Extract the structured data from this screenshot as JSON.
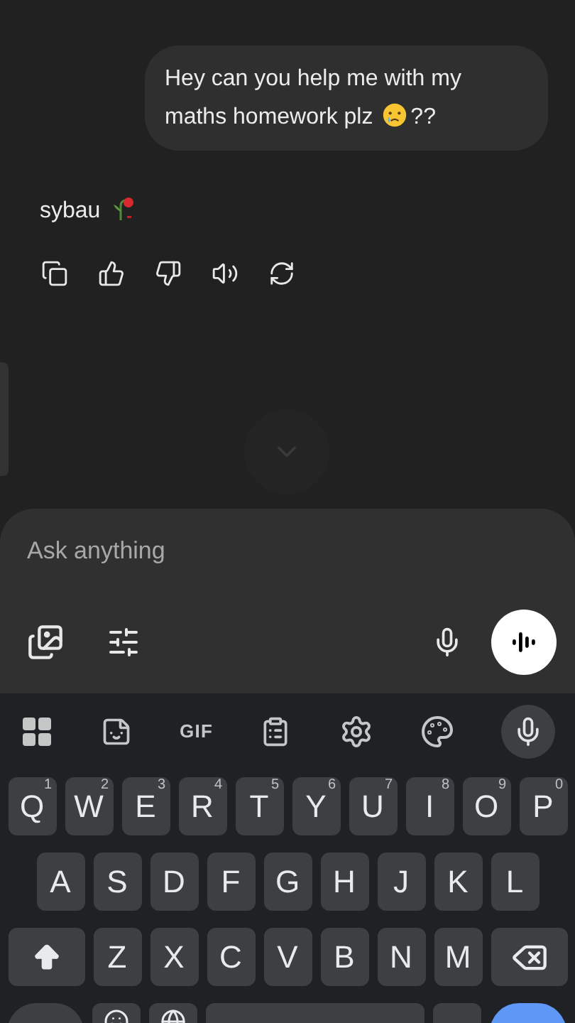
{
  "chat": {
    "user_message": {
      "text_before": "Hey can you help me with my maths homework plz",
      "text_after": "??"
    },
    "reply": {
      "text": "sybau"
    }
  },
  "composer": {
    "placeholder": "Ask anything"
  },
  "keyboard": {
    "toolbar": [
      {
        "kind": "apps"
      },
      {
        "kind": "sticker"
      },
      {
        "kind": "text",
        "label": "GIF"
      },
      {
        "kind": "clipboard"
      },
      {
        "kind": "settings"
      },
      {
        "kind": "theme"
      },
      {
        "kind": "voice"
      }
    ],
    "rows": [
      [
        {
          "kind": "letter",
          "label": "Q",
          "hint": "1"
        },
        {
          "kind": "letter",
          "label": "W",
          "hint": "2"
        },
        {
          "kind": "letter",
          "label": "E",
          "hint": "3"
        },
        {
          "kind": "letter",
          "label": "R",
          "hint": "4"
        },
        {
          "kind": "letter",
          "label": "T",
          "hint": "5"
        },
        {
          "kind": "letter",
          "label": "Y",
          "hint": "6"
        },
        {
          "kind": "letter",
          "label": "U",
          "hint": "7"
        },
        {
          "kind": "letter",
          "label": "I",
          "hint": "8"
        },
        {
          "kind": "letter",
          "label": "O",
          "hint": "9"
        },
        {
          "kind": "letter",
          "label": "P",
          "hint": "0"
        }
      ],
      [
        {
          "kind": "letter",
          "label": "A"
        },
        {
          "kind": "letter",
          "label": "S"
        },
        {
          "kind": "letter",
          "label": "D"
        },
        {
          "kind": "letter",
          "label": "F"
        },
        {
          "kind": "letter",
          "label": "G"
        },
        {
          "kind": "letter",
          "label": "H"
        },
        {
          "kind": "letter",
          "label": "J"
        },
        {
          "kind": "letter",
          "label": "K"
        },
        {
          "kind": "letter",
          "label": "L"
        }
      ],
      [
        {
          "kind": "shift"
        },
        {
          "kind": "letter",
          "label": "Z"
        },
        {
          "kind": "letter",
          "label": "X"
        },
        {
          "kind": "letter",
          "label": "C"
        },
        {
          "kind": "letter",
          "label": "V"
        },
        {
          "kind": "letter",
          "label": "B"
        },
        {
          "kind": "letter",
          "label": "N"
        },
        {
          "kind": "letter",
          "label": "M"
        },
        {
          "kind": "backspace"
        }
      ]
    ]
  }
}
